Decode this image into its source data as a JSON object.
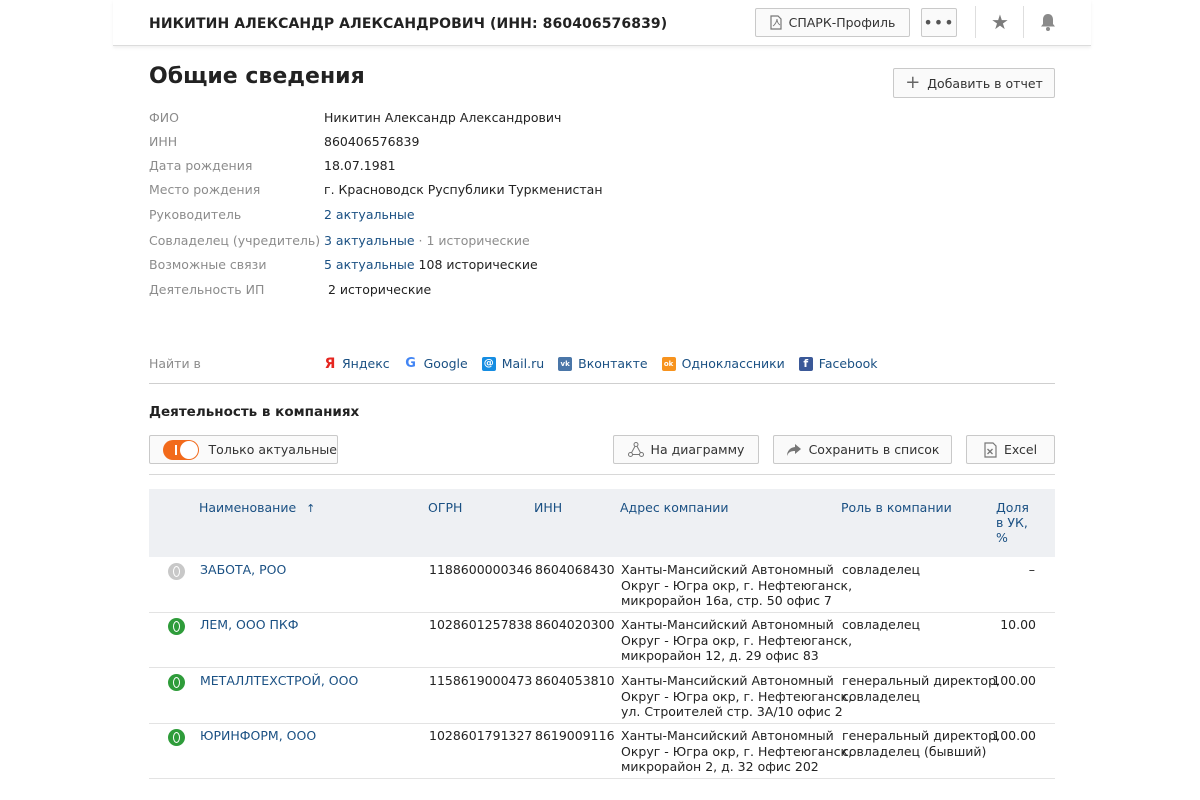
{
  "header": {
    "title": "НИКИТИН АЛЕКСАНДР АЛЕКСАНДРОВИЧ (ИНН: 860406576839)",
    "spark_label": "СПАРК-Профиль",
    "more_label": "•••"
  },
  "general": {
    "heading": "Общие сведения",
    "add_report_label": "Добавить в отчет",
    "rows": [
      {
        "label": "ФИО",
        "value": "Никитин Александр Александрович"
      },
      {
        "label": "ИНН",
        "value": "860406576839"
      },
      {
        "label": "Дата рождения",
        "value": "18.07.1981"
      },
      {
        "label": "Место рождения",
        "value": "г. Красноводск Руспублики Туркменистан"
      },
      {
        "label": "Руководитель",
        "link": "2 актуальные"
      },
      {
        "label": "Совладелец (учредитель)",
        "link": "3 актуальные",
        "sep": " · ",
        "muted": "1 исторические"
      },
      {
        "label": "Возможные связи",
        "link": "5 актуальные",
        "plain": " 108 исторические"
      },
      {
        "label": "Деятельность ИП",
        "muted": "2 исторические"
      }
    ]
  },
  "find": {
    "label": "Найти в",
    "links": [
      {
        "label": "Яндекс",
        "icon": "yandex-icon",
        "color": "#e52620",
        "glyph": "Я"
      },
      {
        "label": "Google",
        "icon": "google-icon",
        "color": "#4285f4",
        "glyph": "G"
      },
      {
        "label": "Mail.ru",
        "icon": "mailru-icon",
        "color": "#168de2",
        "glyph": "@"
      },
      {
        "label": "Вконтакте",
        "icon": "vk-icon",
        "color": "#4a76a8",
        "glyph": "vk"
      },
      {
        "label": "Одноклассники",
        "icon": "ok-icon",
        "color": "#f7931e",
        "glyph": "ok"
      },
      {
        "label": "Facebook",
        "icon": "facebook-icon",
        "color": "#3b5998",
        "glyph": "f"
      }
    ]
  },
  "activity": {
    "heading": "Деятельность в компаниях",
    "toggle_label": "Только актуальные",
    "diagram_label": "На диаграмму",
    "save_label": "Сохранить в список",
    "excel_label": "Excel"
  },
  "table": {
    "headers": {
      "name": "Наименование",
      "sort_arrow": "↑",
      "ogrn": "ОГРН",
      "inn": "ИНН",
      "address": "Адрес компании",
      "role": "Роль в компании",
      "share_1": "Доля",
      "share_2": "в УК,",
      "share_3": "%"
    },
    "rows": [
      {
        "status": "inactive",
        "name": "ЗАБОТА, РОО",
        "ogrn": "1188600000346",
        "inn": "8604068430",
        "addr1": "Ханты-Мансийский Автономный",
        "addr2": "Округ - Югра окр, г. Нефтеюганск,",
        "addr3": "микрорайон 16а, стр. 50 офис 7",
        "role1": "совладелец",
        "role2": "",
        "share": "–"
      },
      {
        "status": "active",
        "name": "ЛЕМ, ООО ПКФ",
        "ogrn": "1028601257838",
        "inn": "8604020300",
        "addr1": "Ханты-Мансийский Автономный",
        "addr2": "Округ - Югра окр, г. Нефтеюганск,",
        "addr3": "микрорайон 12, д. 29 офис 83",
        "role1": "совладелец",
        "role2": "",
        "share": "10.00"
      },
      {
        "status": "active",
        "name": "МЕТАЛЛТЕХСТРОЙ, ООО",
        "ogrn": "1158619000473",
        "inn": "8604053810",
        "addr1": "Ханты-Мансийский Автономный",
        "addr2": "Округ - Югра окр, г. Нефтеюганск,",
        "addr3": "ул. Строителей стр. 3А/10 офис 2",
        "role1": "генеральный директор,",
        "role2": "совладелец",
        "share": "100.00"
      },
      {
        "status": "active",
        "name": "ЮРИНФОРМ, ООО",
        "ogrn": "1028601791327",
        "inn": "8619009116",
        "addr1": "Ханты-Мансийский Автономный",
        "addr2": "Округ - Югра окр, г. Нефтеюганск,",
        "addr3": "микрорайон 2, д. 32 офис 202",
        "role1": "генеральный директор,",
        "role2": "совладелец (бывший)",
        "share": "100.00"
      }
    ]
  }
}
